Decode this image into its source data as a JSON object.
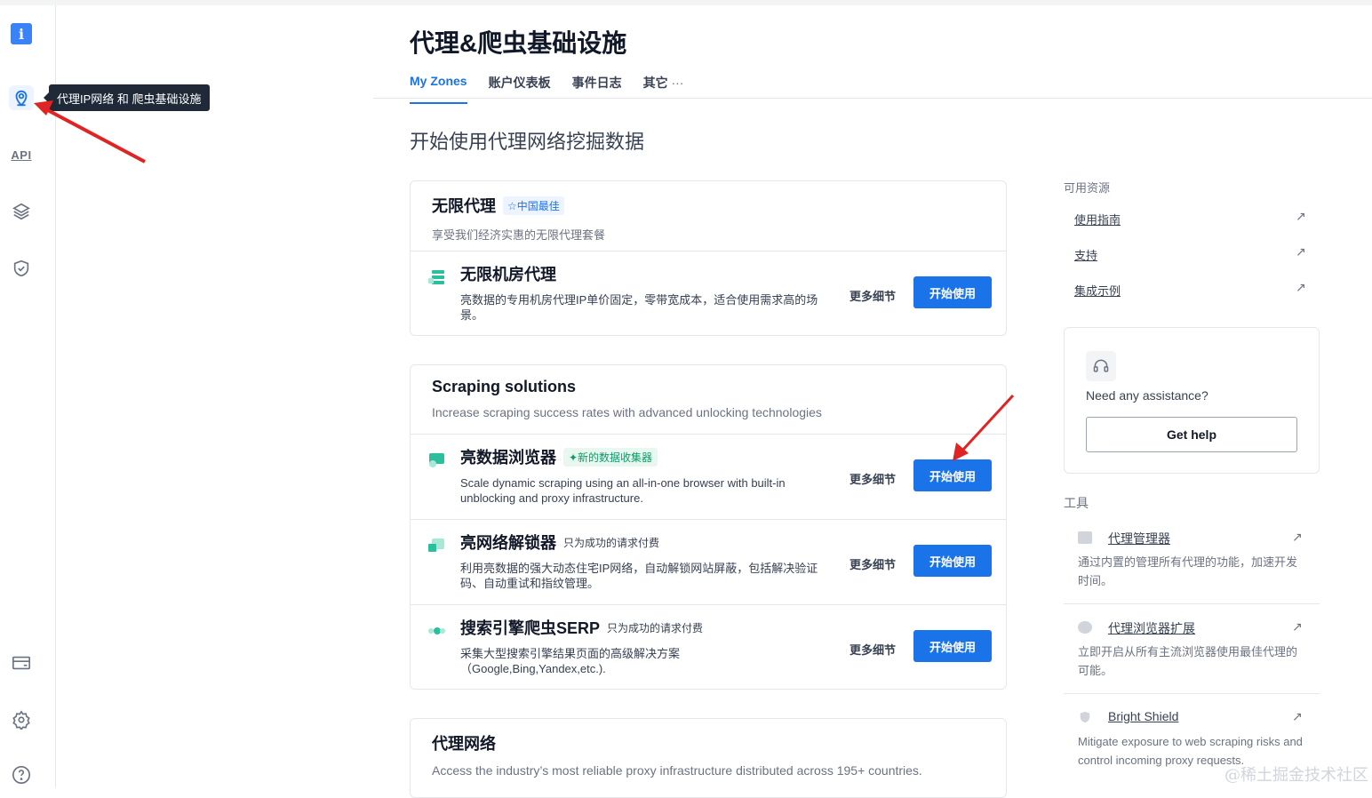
{
  "page_title": "代理&爬虫基础设施",
  "tabs": {
    "my_zones": "My Zones",
    "dashboard": "账户仪表板",
    "event_log": "事件日志",
    "other": "其它",
    "other_more": "···"
  },
  "section_title": "开始使用代理网络挖掘数据",
  "sidebar": {
    "info": "i",
    "api": "API",
    "tooltip": "代理IP网络 和 爬虫基础设施"
  },
  "card1": {
    "title": "无限代理",
    "badge": "☆中国最佳",
    "subtitle": "享受我们经济实惠的无限代理套餐",
    "rows": [
      {
        "title": "无限机房代理",
        "desc": "亮数据的专用机房代理IP单价固定，零带宽成本，适合使用需求高的场景。",
        "more": "更多细节",
        "button": "开始使用"
      }
    ]
  },
  "card2": {
    "title": "Scraping solutions",
    "subtitle": "Increase scraping success rates with advanced unlocking technologies",
    "rows": [
      {
        "title": "亮数据浏览器",
        "badge": "✦新的数据收集器",
        "desc": "Scale dynamic scraping using an all-in-one browser with built-in unblocking and proxy infrastructure.",
        "more": "更多细节",
        "button": "开始使用"
      },
      {
        "title": "亮网络解锁器",
        "note": "只为成功的请求付费",
        "desc": "利用亮数据的强大动态住宅IP网络，自动解锁网站屏蔽，包括解决验证码、自动重试和指纹管理。",
        "more": "更多细节",
        "button": "开始使用"
      },
      {
        "title": "搜索引擎爬虫SERP",
        "note": "只为成功的请求付费",
        "desc": "采集大型搜索引擎结果页面的高级解决方案（Google,Bing,Yandex,etc.).",
        "more": "更多细节",
        "button": "开始使用"
      }
    ]
  },
  "card3": {
    "title": "代理网络",
    "subtitle": "Access the industry’s most reliable proxy infrastructure distributed across 195+ countries."
  },
  "right_panel": {
    "resources_label": "可用资源",
    "resources": [
      "使用指南",
      "支持",
      "集成示例"
    ],
    "assist_text": "Need any assistance?",
    "help_button": "Get help",
    "tools_label": "工具",
    "tools": [
      {
        "title": "代理管理器",
        "desc": "通过内置的管理所有代理的功能，加速开发时间。"
      },
      {
        "title": "代理浏览器扩展",
        "desc": "立即开启从所有主流浏览器使用最佳代理的可能。"
      },
      {
        "title": "Bright Shield",
        "desc": "Mitigate exposure to web scraping risks and control incoming proxy requests."
      }
    ]
  },
  "watermark": "@稀土掘金技术社区",
  "colors": {
    "primary": "#1a73e8",
    "accent_green": "#2bbf9d",
    "annotation_arrow": "#e02424"
  }
}
